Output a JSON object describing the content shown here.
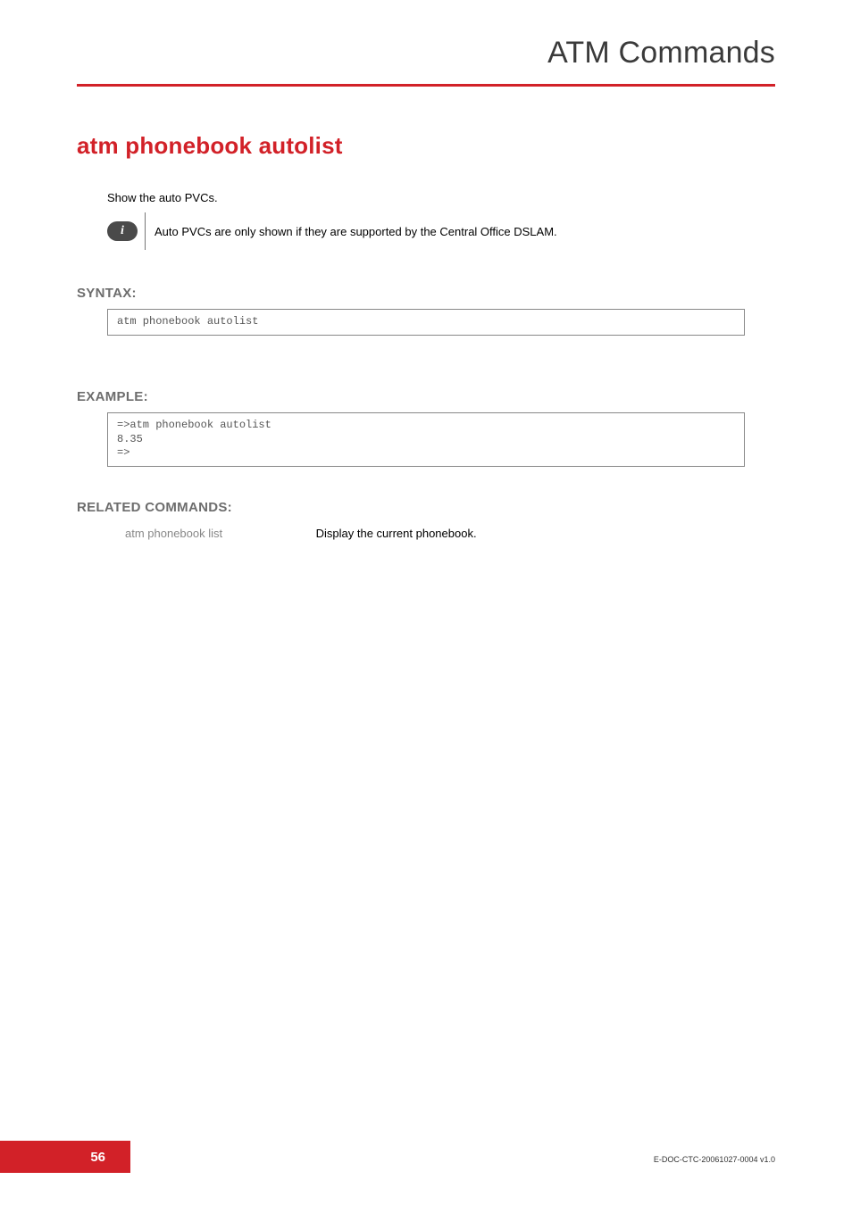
{
  "header": {
    "title": "ATM Commands"
  },
  "command": {
    "title": "atm phonebook autolist",
    "intro": "Show the auto PVCs.",
    "info_note": "Auto PVCs are only shown if they are supported by the Central Office DSLAM."
  },
  "sections": {
    "syntax_label": "SYNTAX:",
    "example_label": "EXAMPLE:",
    "related_label": "RELATED COMMANDS:"
  },
  "syntax": "atm phonebook autolist",
  "example": "=>atm phonebook autolist\n8.35\n=>",
  "related": {
    "cmd": "atm phonebook list",
    "desc": "Display the current phonebook."
  },
  "footer": {
    "page": "56",
    "docid": "E-DOC-CTC-20061027-0004 v1.0"
  },
  "icons": {
    "info_glyph": "i"
  }
}
